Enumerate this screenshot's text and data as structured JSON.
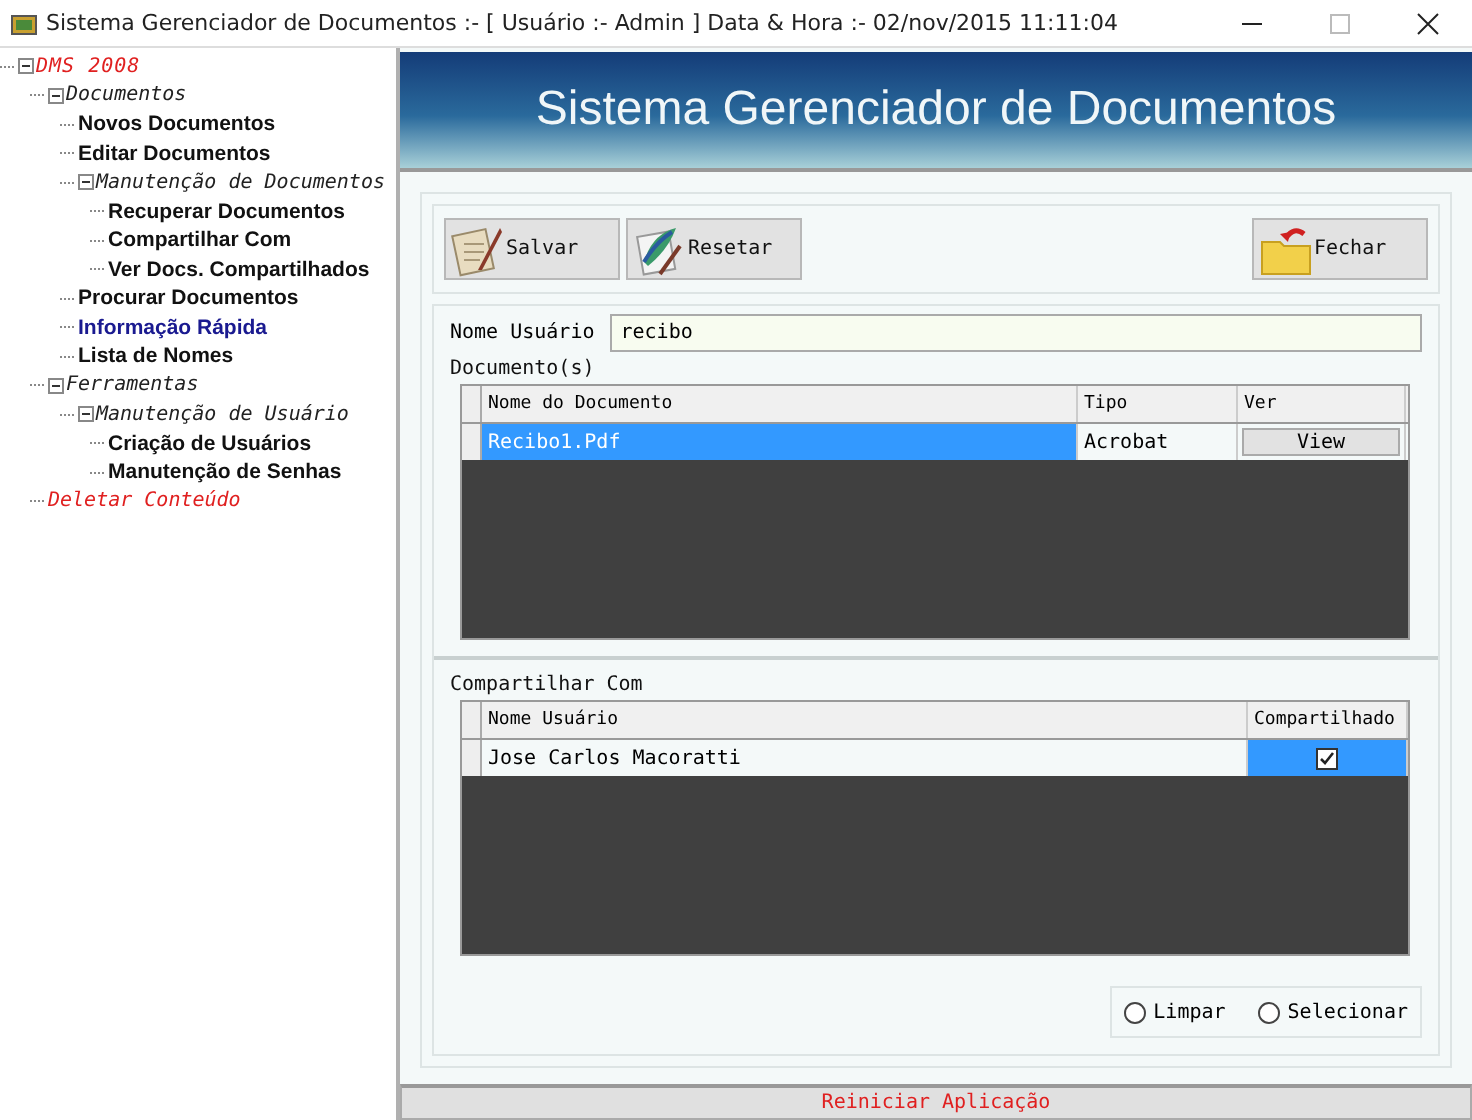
{
  "window": {
    "title": "Sistema Gerenciador de Documentos :- [ Usuário :- Admin ]  Data & Hora :- 02/nov/2015 11:11:04"
  },
  "tree": [
    {
      "label": "DMS 2008",
      "kind": "root",
      "expanded": true,
      "children": [
        {
          "label": "Documentos",
          "kind": "group",
          "expanded": true,
          "children": [
            {
              "label": "Novos Documentos",
              "kind": "item"
            },
            {
              "label": "Editar Documentos",
              "kind": "item"
            },
            {
              "label": "Manutenção de Documentos",
              "kind": "group",
              "expanded": true,
              "children": [
                {
                  "label": "Recuperar Documentos",
                  "kind": "item"
                },
                {
                  "label": "Compartilhar Com",
                  "kind": "item"
                },
                {
                  "label": "Ver Docs. Compartilhados",
                  "kind": "item"
                }
              ]
            },
            {
              "label": "Procurar Documentos",
              "kind": "item"
            },
            {
              "label": "Informação Rápida",
              "kind": "link"
            },
            {
              "label": "Lista de Nomes",
              "kind": "item"
            }
          ]
        },
        {
          "label": "Ferramentas",
          "kind": "group",
          "expanded": true,
          "children": [
            {
              "label": "Manutenção de Usuário",
              "kind": "group",
              "expanded": true,
              "children": [
                {
                  "label": "Criação de Usuários",
                  "kind": "item"
                },
                {
                  "label": "Manutenção de Senhas",
                  "kind": "item"
                }
              ]
            }
          ]
        },
        {
          "label": "Deletar Conteúdo",
          "kind": "danger"
        }
      ]
    }
  ],
  "header": {
    "title": "Sistema Gerenciador de Documentos"
  },
  "toolbar": [
    {
      "label": "Salvar",
      "kind": "save"
    },
    {
      "label": "Resetar",
      "kind": "reset"
    },
    {
      "label": "Fechar",
      "kind": "close"
    }
  ],
  "user_field": {
    "label": "Nome Usuário",
    "value": "recibo"
  },
  "documents": {
    "label": "Documento(s)",
    "columns": [
      "Nome do Documento",
      "Tipo",
      "Ver"
    ],
    "rows": [
      {
        "name": "Recibo1.Pdf",
        "type": "Acrobat",
        "view": "View",
        "selected": true
      }
    ]
  },
  "share": {
    "label": "Compartilhar Com",
    "columns": [
      "Nome Usuário",
      "Compartilhado"
    ],
    "rows": [
      {
        "name": "Jose Carlos Macoratti",
        "shared": true,
        "selected": true
      }
    ]
  },
  "radios": [
    {
      "label": "Limpar",
      "selected": false
    },
    {
      "label": "Selecionar",
      "selected": false
    }
  ],
  "footer_button": "Reiniciar Aplicação"
}
